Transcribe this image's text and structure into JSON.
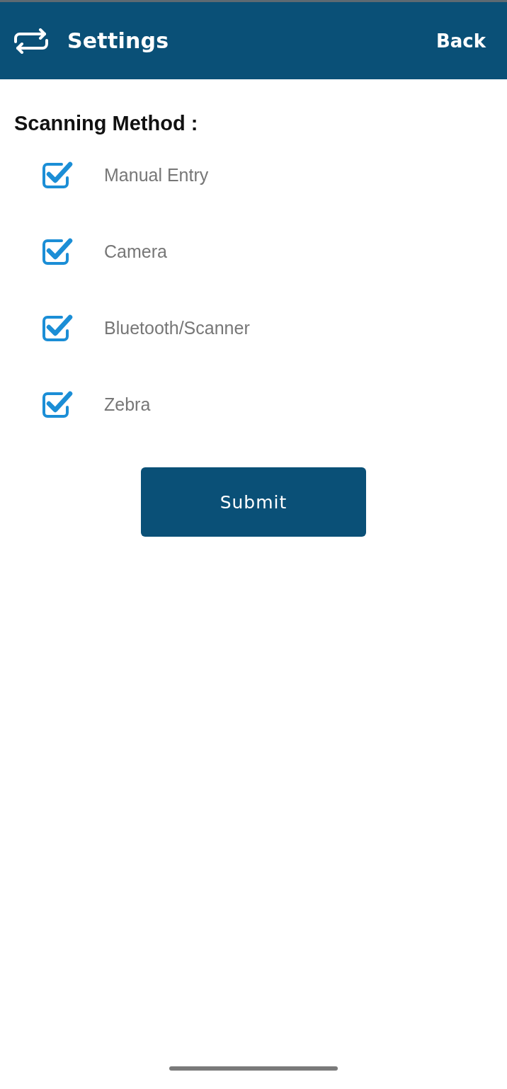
{
  "header": {
    "title": "Settings",
    "back": "Back"
  },
  "section": {
    "heading": "Scanning Method :"
  },
  "options": [
    {
      "label": "Manual Entry",
      "checked": true
    },
    {
      "label": "Camera",
      "checked": true
    },
    {
      "label": "Bluetooth/Scanner",
      "checked": true
    },
    {
      "label": "Zebra",
      "checked": true
    }
  ],
  "submit": "Submit"
}
